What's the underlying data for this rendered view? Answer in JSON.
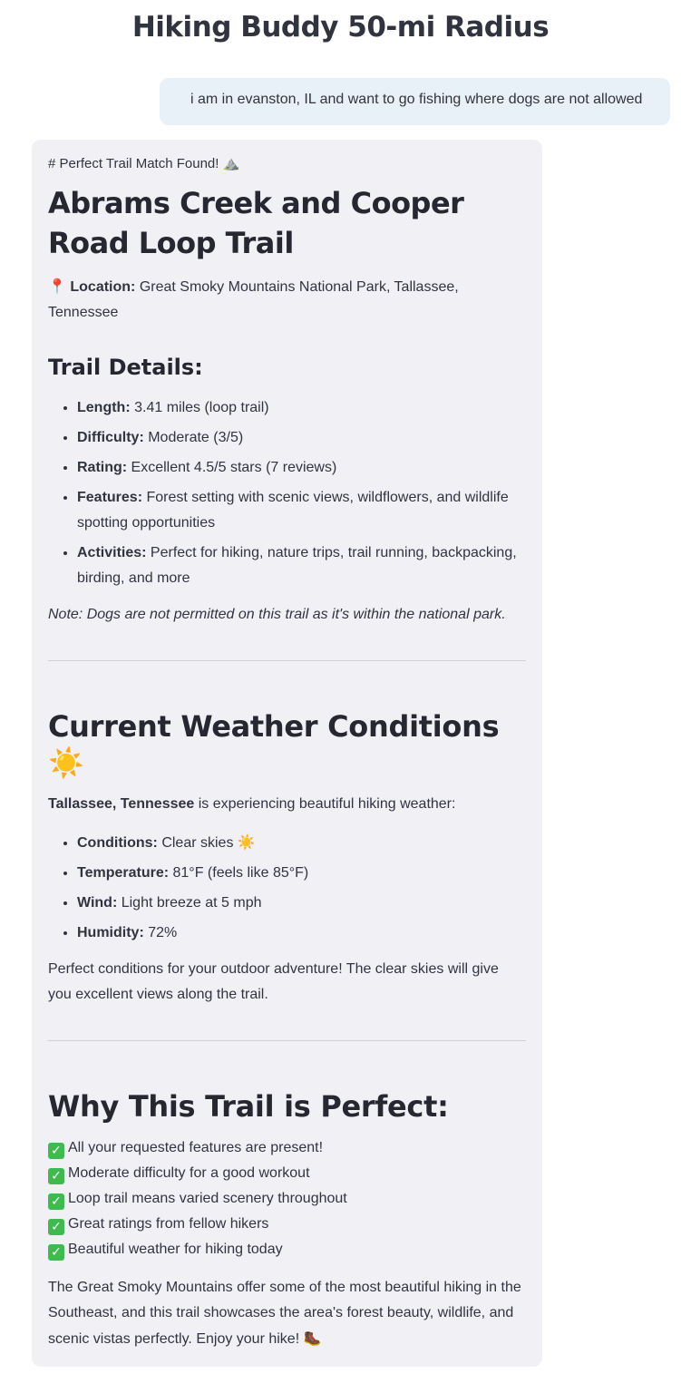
{
  "header": {
    "title": "Hiking Buddy 50-mi Radius"
  },
  "user_message": {
    "text": "i am in evanston, IL and want to go fishing where dogs are not allowed"
  },
  "reply": {
    "raw_heading": "# Perfect Trail Match Found! ⛰️",
    "trail_name": "Abrams Creek and Cooper Road Loop Trail",
    "location_icon": "📍",
    "location_label": "Location:",
    "location_value": " Great Smoky Mountains National Park, Tallassee, Tennessee",
    "details_heading": "Trail Details:",
    "details": [
      {
        "label": "Length:",
        "value": " 3.41 miles (loop trail)"
      },
      {
        "label": "Difficulty:",
        "value": " Moderate (3/5)"
      },
      {
        "label": "Rating:",
        "value": " Excellent 4.5/5 stars (7 reviews)"
      },
      {
        "label": "Features:",
        "value": " Forest setting with scenic views, wildflowers, and wildlife spotting opportunities"
      },
      {
        "label": "Activities:",
        "value": " Perfect for hiking, nature trips, trail running, backpacking, birding, and more"
      }
    ],
    "note": "Note: Dogs are not permitted on this trail as it's within the national park.",
    "weather_heading": "Current Weather Conditions",
    "weather_heading_icon": "☀️",
    "weather_intro_place": "Tallassee, Tennessee",
    "weather_intro_rest": " is experiencing beautiful hiking weather:",
    "weather": [
      {
        "label": "Conditions:",
        "value": " Clear skies ",
        "icon": "☀️"
      },
      {
        "label": "Temperature:",
        "value": " 81°F (feels like 85°F)"
      },
      {
        "label": "Wind:",
        "value": " Light breeze at 5 mph"
      },
      {
        "label": "Humidity:",
        "value": " 72%"
      }
    ],
    "weather_summary": "Perfect conditions for your outdoor adventure! The clear skies will give you excellent views along the trail.",
    "why_heading": "Why This Trail is Perfect:",
    "checkmark": "✓",
    "why_items": [
      "All your requested features are present!",
      "Moderate difficulty for a good workout",
      "Loop trail means varied scenery throughout",
      "Great ratings from fellow hikers",
      "Beautiful weather for hiking today"
    ],
    "closing": "The Great Smoky Mountains offer some of the most beautiful hiking in the Southeast, and this trail showcases the area's forest beauty, wildlife, and scenic vistas perfectly. Enjoy your hike! ",
    "closing_icon": "🥾",
    "colors": {
      "check_green": "#3fb950",
      "user_bubble": "#e8f0f8",
      "reply_card": "#f1f1f5"
    }
  }
}
